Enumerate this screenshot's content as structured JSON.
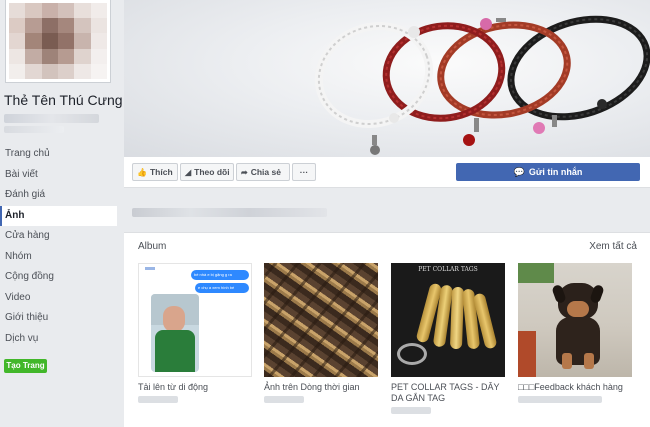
{
  "page": {
    "name": "Thẻ Tên Thú Cưng"
  },
  "nav": {
    "items": [
      {
        "label": "Trang chủ",
        "active": false
      },
      {
        "label": "Bài viết",
        "active": false
      },
      {
        "label": "Đánh giá",
        "active": false
      },
      {
        "label": "Ảnh",
        "active": true
      },
      {
        "label": "Cửa hàng",
        "active": false
      },
      {
        "label": "Nhóm",
        "active": false
      },
      {
        "label": "Cộng đồng",
        "active": false
      },
      {
        "label": "Video",
        "active": false
      },
      {
        "label": "Giới thiệu",
        "active": false
      },
      {
        "label": "Dịch vụ",
        "active": false
      }
    ],
    "create_page": "Tạo Trang"
  },
  "actions": {
    "like": "Thích",
    "follow": "Theo dõi",
    "share": "Chia sẻ",
    "more": "···",
    "send_message": "Gửi tin nhắn"
  },
  "albums": {
    "title": "Album",
    "see_all": "Xem tất cả",
    "items": [
      {
        "name": "Tải lên từ di động"
      },
      {
        "name": "Ảnh trên Dòng thời gian"
      },
      {
        "name": "PET COLLAR TAGS - DÂY DA GẮN TAG"
      },
      {
        "name": "□□□Feedback khách hàng"
      }
    ],
    "tags_photo_caption": "PET COLLAR TAGS",
    "chat_bubbles": [
      "bé nhà e bị gặng g ra",
      "e chụ a xem hình bé"
    ]
  },
  "colors": {
    "brand_blue": "#4267b2",
    "create_green": "#42b72a",
    "page_bg": "#e9ebee"
  },
  "icons": {
    "like": "thumbs-up-icon",
    "follow": "rss-icon",
    "share": "share-arrow-icon",
    "messenger": "messenger-icon"
  }
}
